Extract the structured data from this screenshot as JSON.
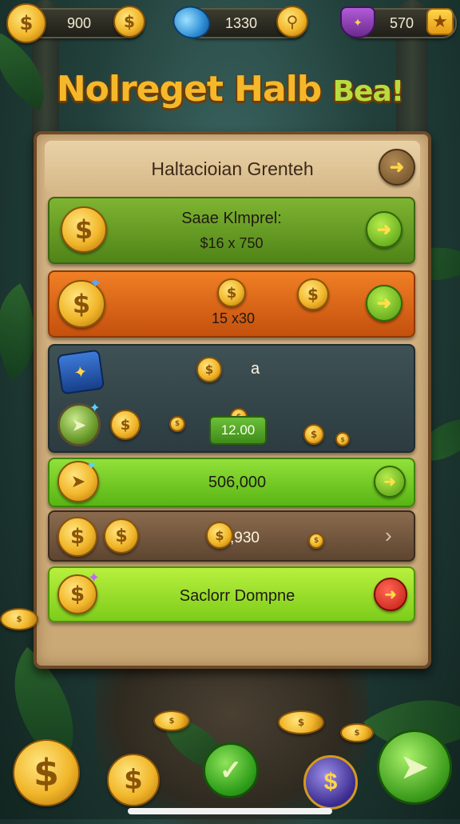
{
  "resources": {
    "coins": "900",
    "gems": "1330",
    "shield": "570"
  },
  "icons": {
    "coin": "dollar-coin-icon",
    "gem": "blue-gem-icon",
    "search": "magnifier-coin-icon",
    "shield": "purple-shield-icon",
    "star": "star-icon",
    "arrow": "arrow-right-icon",
    "chest": "treasure-chest-icon"
  },
  "title": {
    "part1": "Nolreget Halb",
    "part2": "Bea!"
  },
  "board": {
    "header": "Haltacioian Grenteh",
    "rows": {
      "row1_label": "Saae Klmprel:",
      "row1_value": "$16 x 750",
      "row2_value": "15 x30",
      "row3_count": "a",
      "row3_amount": "12.00",
      "row4_value": "506,000",
      "row5_value": ",930",
      "row6_label": "Saclorr Dompne"
    }
  },
  "colors": {
    "accent_gold": "#f5b82a",
    "accent_green": "#7fb431",
    "accent_orange": "#f07f25",
    "panel_wood": "#d9b98a"
  }
}
